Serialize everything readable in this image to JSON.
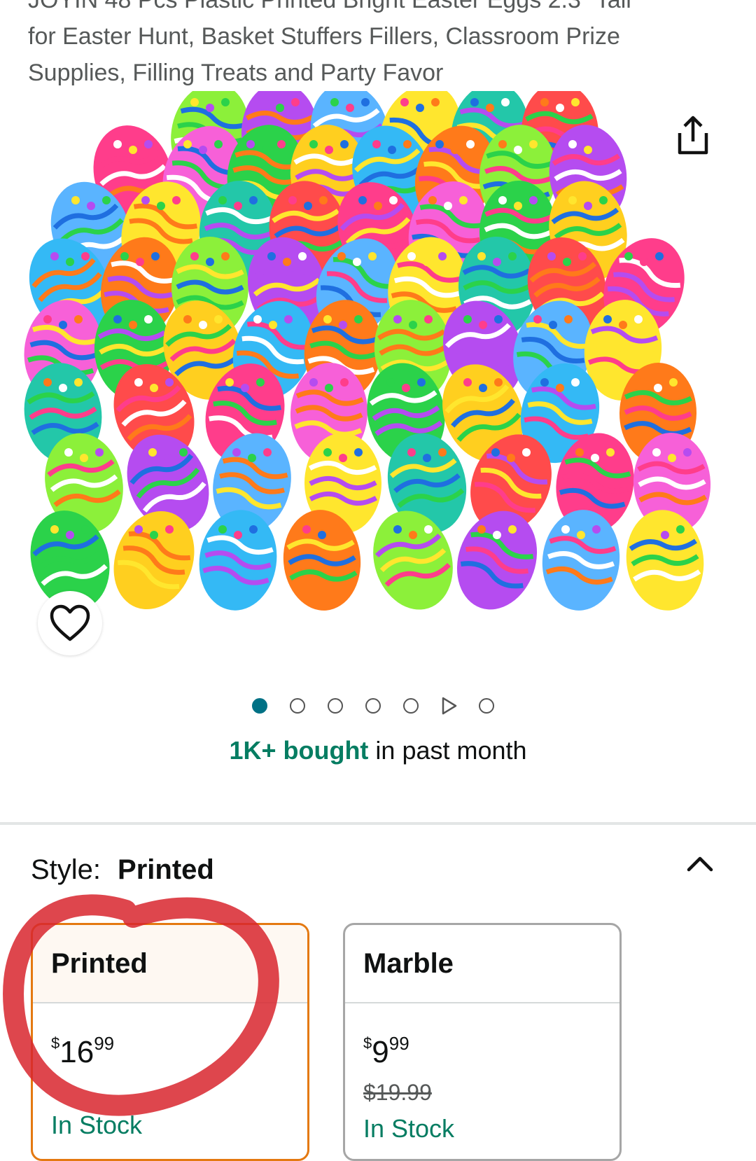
{
  "product": {
    "title_lines": [
      "JOYIN 48 Pcs Plastic Printed Bright Easter Eggs 2.3\" Tall",
      "for Easter Hunt, Basket Stuffers Fillers, Classroom Prize",
      "Supplies, Filling Treats and Party Favor"
    ]
  },
  "gallery": {
    "image": "easter-eggs-photo",
    "share_icon": "share-icon",
    "heart_icon": "heart-icon",
    "dots": [
      {
        "type": "dot",
        "active": true
      },
      {
        "type": "dot",
        "active": false
      },
      {
        "type": "dot",
        "active": false
      },
      {
        "type": "dot",
        "active": false
      },
      {
        "type": "dot",
        "active": false
      },
      {
        "type": "video",
        "active": false
      },
      {
        "type": "dot",
        "active": false
      }
    ]
  },
  "social_proof": {
    "highlight": "1K+ bought",
    "rest": " in past month"
  },
  "style_selector": {
    "label": "Style:",
    "value": "Printed",
    "options": [
      {
        "name": "Printed",
        "currency": "$",
        "whole": "16",
        "cents": "99",
        "was": "",
        "stock": "In Stock",
        "selected": true
      },
      {
        "name": "Marble",
        "currency": "$",
        "whole": "9",
        "cents": "99",
        "was": "$19.99",
        "stock": "In Stock",
        "selected": false
      }
    ]
  },
  "colors": {
    "accent_teal": "#007185",
    "stock_green": "#067d62",
    "selected_border": "#e47911",
    "annotation_red": "#d8262e"
  }
}
